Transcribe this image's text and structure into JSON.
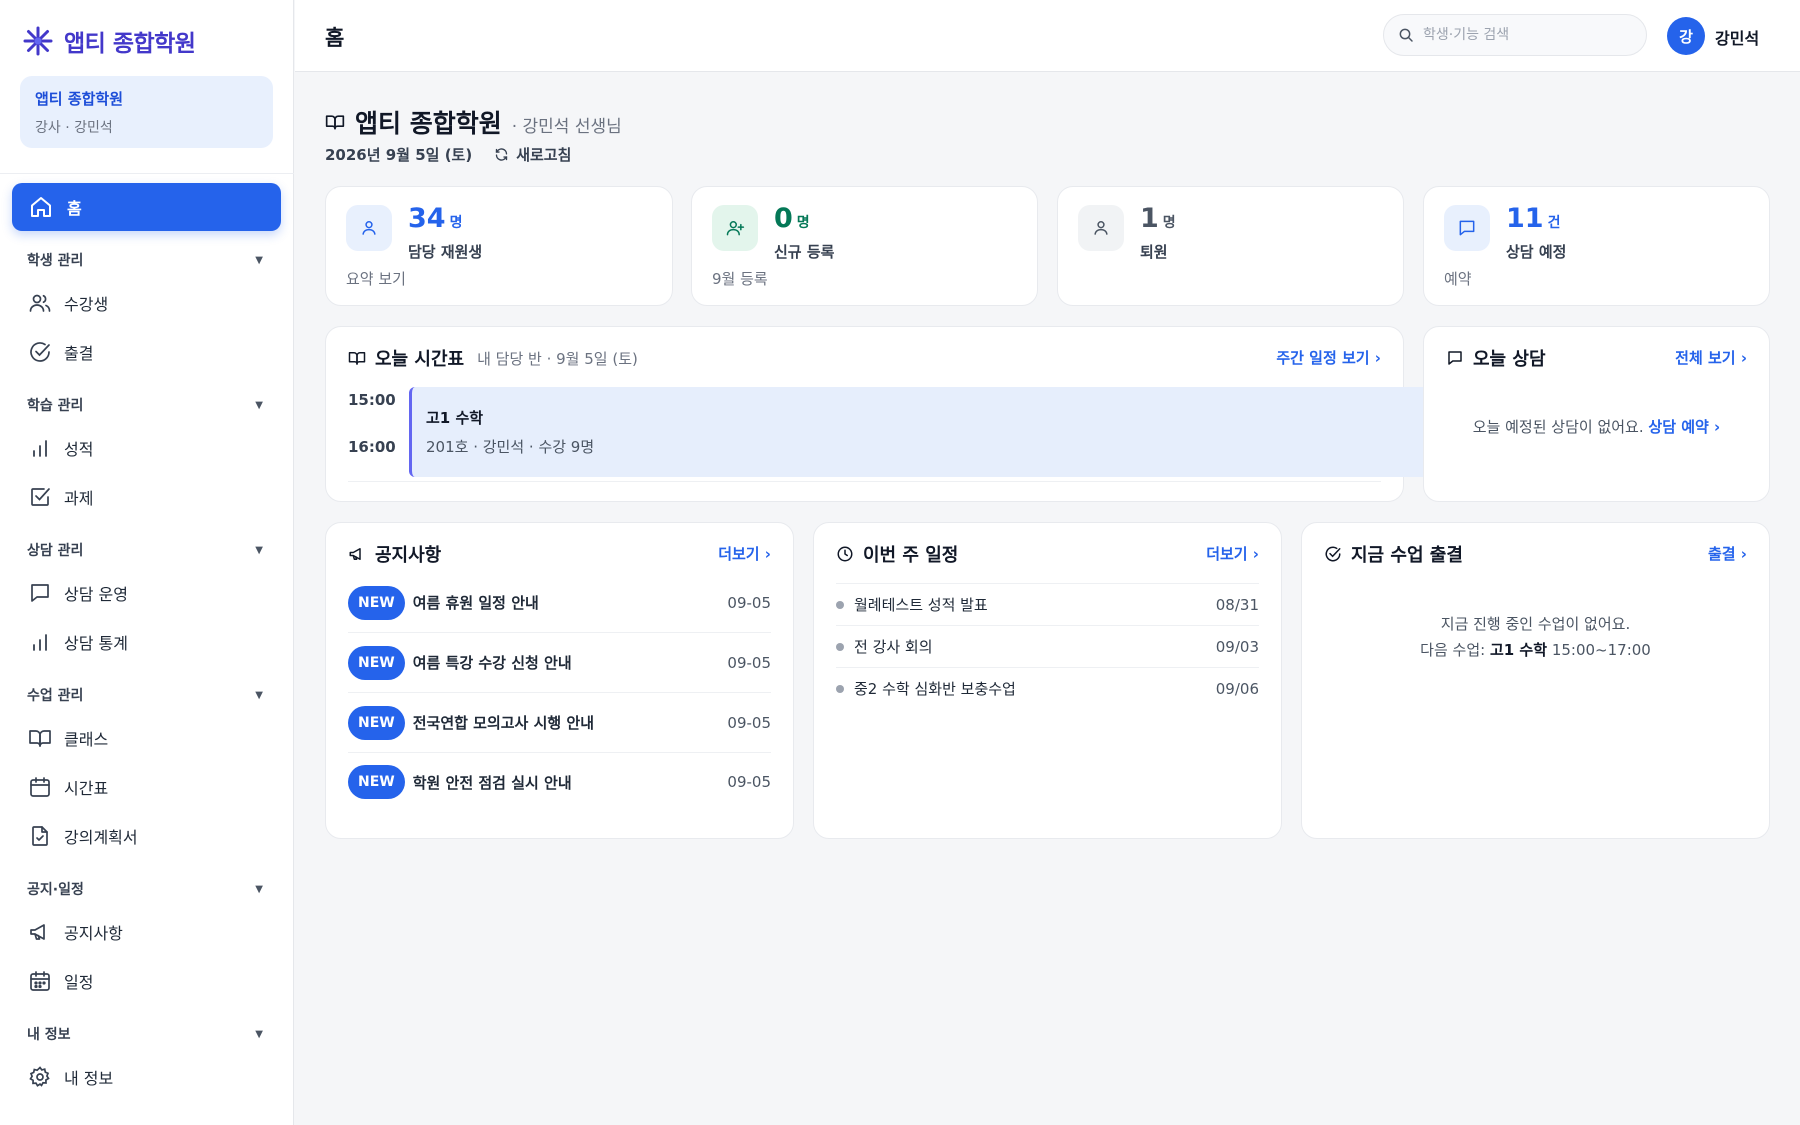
{
  "app": {
    "logo_text": "앱티 종합학원",
    "brand_color": "#4338ca",
    "accent": "#2563eb"
  },
  "org": {
    "name": "앱티 종합학원",
    "role": "강사 · 강민석"
  },
  "nav": {
    "home": "홈",
    "groups": [
      {
        "label": "학생 관리",
        "items": [
          {
            "label": "수강생",
            "icon": "users-icon"
          },
          {
            "label": "출결",
            "icon": "check-circle-icon"
          }
        ]
      },
      {
        "label": "학습 관리",
        "items": [
          {
            "label": "성적",
            "icon": "bar-chart-icon"
          },
          {
            "label": "과제",
            "icon": "checkbox-icon"
          }
        ]
      },
      {
        "label": "상담 관리",
        "items": [
          {
            "label": "상담 운영",
            "icon": "message-icon"
          },
          {
            "label": "상담 통계",
            "icon": "bar-chart-icon"
          }
        ]
      },
      {
        "label": "수업 관리",
        "items": [
          {
            "label": "클래스",
            "icon": "book-icon"
          },
          {
            "label": "시간표",
            "icon": "calendar-icon"
          },
          {
            "label": "강의계획서",
            "icon": "file-check-icon"
          }
        ]
      },
      {
        "label": "공지·일정",
        "items": [
          {
            "label": "공지사항",
            "icon": "megaphone-icon"
          },
          {
            "label": "일정",
            "icon": "calendar-grid-icon"
          }
        ]
      },
      {
        "label": "내 정보",
        "items": [
          {
            "label": "내 정보",
            "icon": "gear-icon"
          }
        ]
      }
    ]
  },
  "topbar": {
    "title": "홈",
    "search_placeholder": "학생·기능 검색",
    "avatar_initial": "강",
    "user_name": "강민석"
  },
  "header": {
    "title": "앱티 종합학원",
    "subtitle": "· 강민석 선생님",
    "date": "2026년 9월 5일 (토)",
    "refresh": "새로고침"
  },
  "stats": [
    {
      "value": "34",
      "unit": "명",
      "label": "담당 재원생",
      "foot": "요약 보기",
      "color": "#2563eb",
      "bg": "#e8f0fd"
    },
    {
      "value": "0",
      "unit": "명",
      "label": "신규 등록",
      "foot": "9월 등록",
      "color": "#047857",
      "bg": "#e3f5ec"
    },
    {
      "value": "1",
      "unit": "명",
      "label": "퇴원",
      "foot": "",
      "color": "#4b5563",
      "bg": "#f1f3f5"
    },
    {
      "value": "11",
      "unit": "건",
      "label": "상담 예정",
      "foot": "예약",
      "color": "#2563eb",
      "bg": "#e8f0fd"
    }
  ],
  "timetable": {
    "title": "오늘 시간표",
    "sub": "내 담당 반 · 9월 5일 (토)",
    "link": "주간 일정 보기 ›",
    "times": [
      "15:00",
      "16:00"
    ],
    "event": {
      "title": "고1 수학",
      "meta": "201호 · 강민석 · 수강 9명"
    }
  },
  "consult": {
    "title": "오늘 상담",
    "link": "전체 보기 ›",
    "empty": "오늘 예정된 상담이 없어요.",
    "empty_link": "상담 예약 ›"
  },
  "notices": {
    "title": "공지사항",
    "link": "더보기 ›",
    "items": [
      {
        "badge": "NEW",
        "title": "여름 휴원 일정 안내",
        "date": "09-05"
      },
      {
        "badge": "NEW",
        "title": "여름 특강 수강 신청 안내",
        "date": "09-05"
      },
      {
        "badge": "NEW",
        "title": "전국연합 모의고사 시행 안내",
        "date": "09-05"
      },
      {
        "badge": "NEW",
        "title": "학원 안전 점검 실시 안내",
        "date": "09-05"
      }
    ]
  },
  "schedule": {
    "title": "이번 주 일정",
    "link": "더보기 ›",
    "items": [
      {
        "title": "월례테스트 성적 발표",
        "date": "08/31"
      },
      {
        "title": "전 강사 회의",
        "date": "09/03"
      },
      {
        "title": "중2 수학 심화반 보충수업",
        "date": "09/06"
      }
    ]
  },
  "attendance": {
    "title": "지금 수업 출결",
    "link": "출결 ›",
    "empty1": "지금 진행 중인 수업이 없어요.",
    "empty2_prefix": "다음 수업:",
    "empty2_class": "고1 수학",
    "empty2_time": "15:00~17:00"
  }
}
